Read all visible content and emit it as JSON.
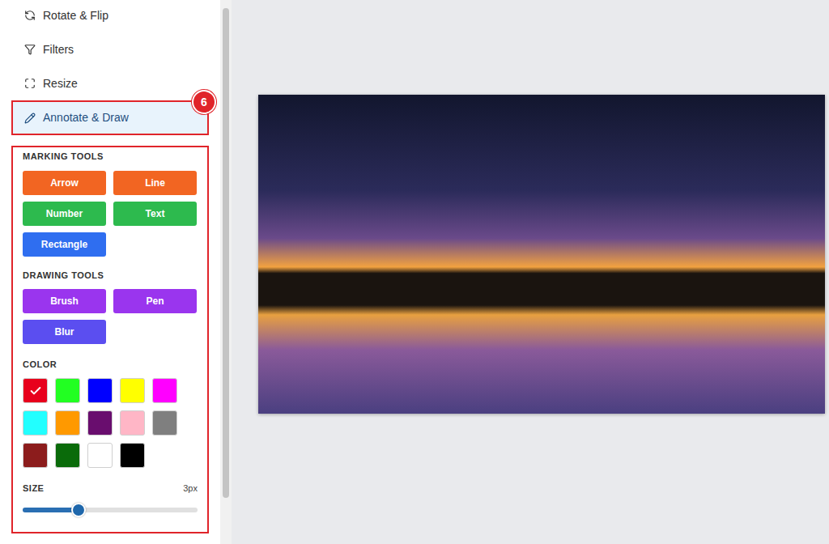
{
  "menu": [
    {
      "label": "Rotate & Flip",
      "selected": false
    },
    {
      "label": "Filters",
      "selected": false
    },
    {
      "label": "Resize",
      "selected": false
    },
    {
      "label": "Annotate & Draw",
      "selected": true
    }
  ],
  "step_badge": "6",
  "marking_tools": {
    "title": "MARKING TOOLS",
    "buttons": [
      {
        "label": "Arrow",
        "color": "#f26522"
      },
      {
        "label": "Line",
        "color": "#f26522"
      },
      {
        "label": "Number",
        "color": "#2dba4e"
      },
      {
        "label": "Text",
        "color": "#2dba4e"
      },
      {
        "label": "Rectangle",
        "color": "#2f6ef0"
      }
    ]
  },
  "drawing_tools": {
    "title": "DRAWING TOOLS",
    "buttons": [
      {
        "label": "Brush",
        "color": "#9a35ee"
      },
      {
        "label": "Pen",
        "color": "#9a35ee"
      },
      {
        "label": "Blur",
        "color": "#5b4ef0"
      }
    ]
  },
  "color": {
    "title": "COLOR",
    "swatches": [
      {
        "color": "#e8001c",
        "selected": true
      },
      {
        "color": "#22ff22",
        "selected": false
      },
      {
        "color": "#0000ff",
        "selected": false
      },
      {
        "color": "#ffff00",
        "selected": false
      },
      {
        "color": "#ff00ff",
        "selected": false
      },
      {
        "color": "#22ffff",
        "selected": false
      },
      {
        "color": "#ff9900",
        "selected": false
      },
      {
        "color": "#690d6e",
        "selected": false
      },
      {
        "color": "#ffb6c6",
        "selected": false
      },
      {
        "color": "#7f7f7f",
        "selected": false
      },
      {
        "color": "#8c1c1c",
        "selected": false
      },
      {
        "color": "#0a6b0a",
        "selected": false
      },
      {
        "color": "#ffffff",
        "selected": false
      },
      {
        "color": "#000000",
        "selected": false
      }
    ]
  },
  "size": {
    "label": "SIZE",
    "reading": "3px",
    "level": 0.32
  }
}
